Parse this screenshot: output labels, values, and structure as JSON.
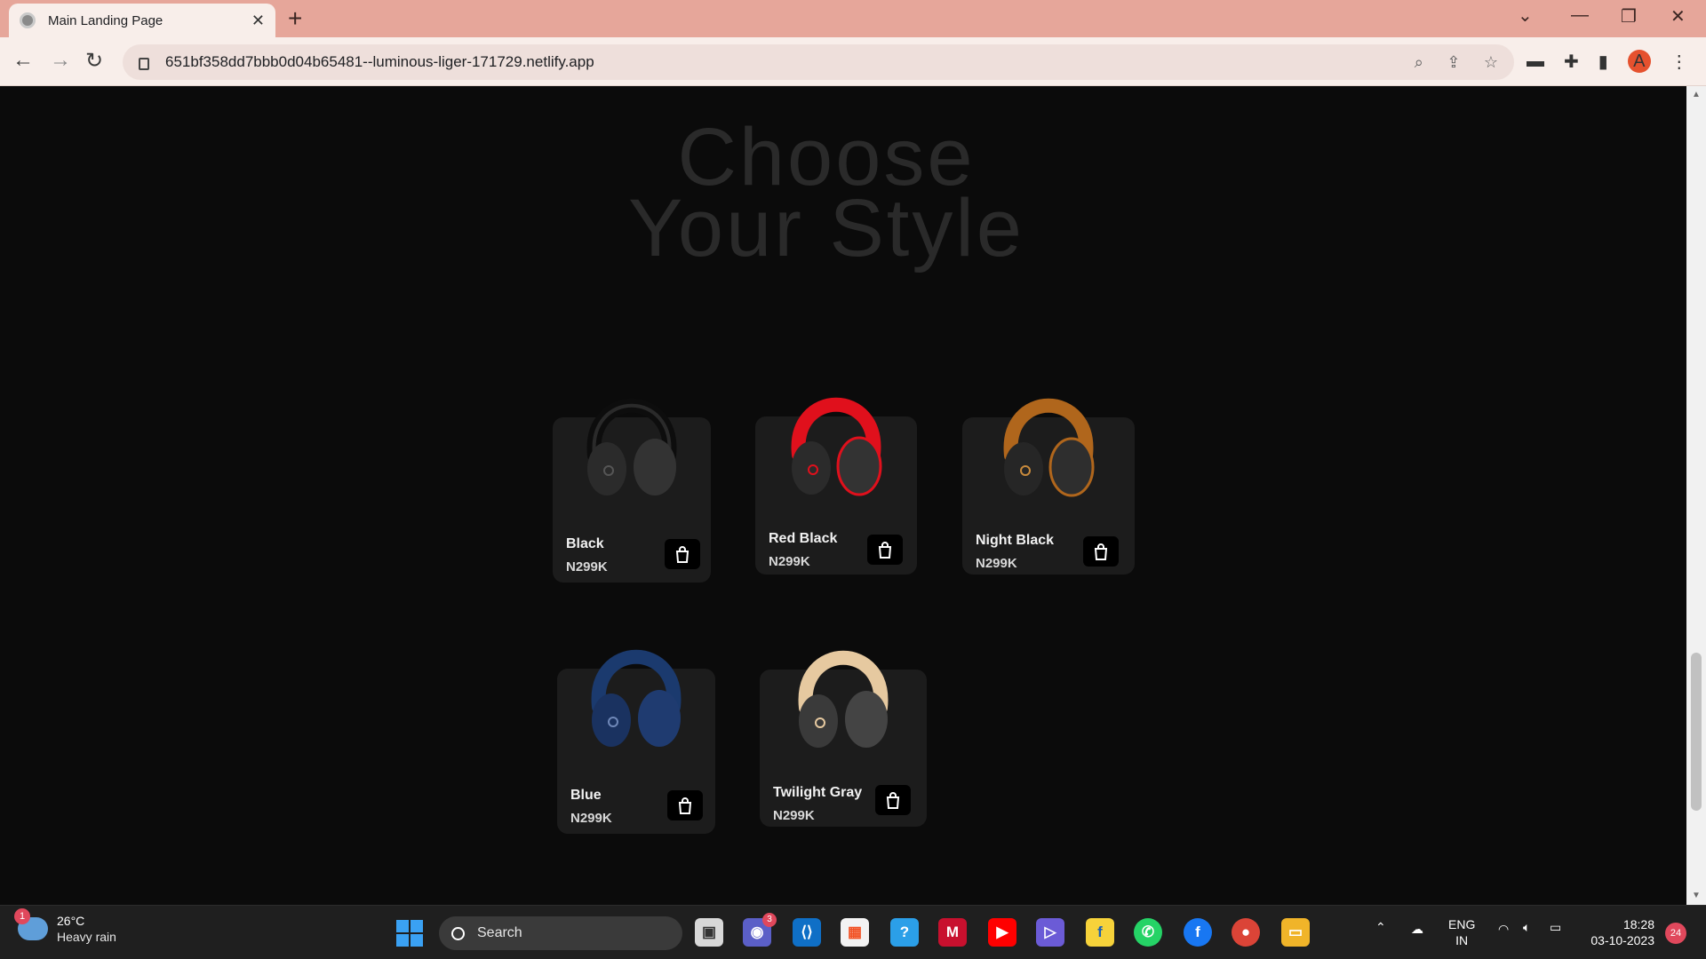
{
  "browser": {
    "tab_title": "Main Landing Page",
    "url": "651bf358dd7bbb0d04b65481--luminous-liger-171729.netlify.app",
    "profile_initial": "A"
  },
  "page": {
    "title_line1": "Choose",
    "title_line2": "Your Style",
    "products": [
      {
        "name": "Black",
        "price": "N299K",
        "accent": "#1a1a1a"
      },
      {
        "name": "Red Black",
        "price": "N299K",
        "accent": "#e0101c"
      },
      {
        "name": "Night Black",
        "price": "N299K",
        "accent": "#b0661c"
      },
      {
        "name": "Blue",
        "price": "N299K",
        "accent": "#1b3a6e"
      },
      {
        "name": "Twilight Gray",
        "price": "N299K",
        "accent": "#e6c9a0"
      }
    ]
  },
  "taskbar": {
    "weather_temp": "26°C",
    "weather_desc": "Heavy rain",
    "weather_badge": "1",
    "search_label": "Search",
    "teams_badge": "3",
    "lang_top": "ENG",
    "lang_bottom": "IN",
    "time": "18:28",
    "date": "03-10-2023",
    "notifications": "24"
  }
}
